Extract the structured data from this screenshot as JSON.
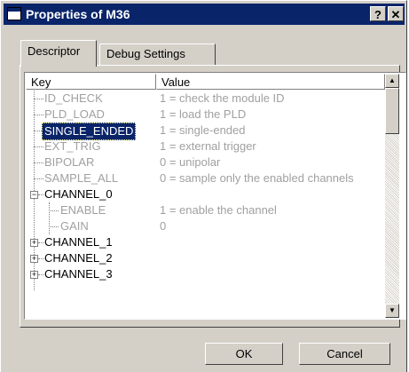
{
  "window": {
    "title": "Properties of M36",
    "help_label": "?",
    "close_label": "✕"
  },
  "tabs": [
    {
      "label": "Descriptor",
      "active": true
    },
    {
      "label": "Debug Settings",
      "active": false
    }
  ],
  "list": {
    "columns": {
      "key": "Key",
      "value": "Value"
    },
    "rows": [
      {
        "key": "ID_CHECK",
        "value": "1 = check the module ID",
        "enabled": false
      },
      {
        "key": "PLD_LOAD",
        "value": "1 = load the PLD",
        "enabled": false
      },
      {
        "key": "SINGLE_ENDED",
        "value": "1 = single-ended",
        "enabled": false,
        "selected": true
      },
      {
        "key": "EXT_TRIG",
        "value": "1 = external trigger",
        "enabled": false
      },
      {
        "key": "BIPOLAR",
        "value": "0 = unipolar",
        "enabled": false
      },
      {
        "key": "SAMPLE_ALL",
        "value": "0 = sample only the enabled channels",
        "enabled": false
      },
      {
        "key": "CHANNEL_0",
        "value": "",
        "enabled": true,
        "expander": "−"
      },
      {
        "key": "ENABLE",
        "value": "1 = enable the channel",
        "enabled": false
      },
      {
        "key": "GAIN",
        "value": "0",
        "enabled": false
      },
      {
        "key": "CHANNEL_1",
        "value": "",
        "enabled": true,
        "expander": "+"
      },
      {
        "key": "CHANNEL_2",
        "value": "",
        "enabled": true,
        "expander": "+"
      },
      {
        "key": "CHANNEL_3",
        "value": "",
        "enabled": true,
        "expander": "+"
      }
    ]
  },
  "buttons": {
    "ok": "OK",
    "cancel": "Cancel"
  },
  "colors": {
    "titlebar": "#0a246a",
    "selection": "#0a246a",
    "disabled_text": "#a0a0a0",
    "face": "#d4d0c8"
  }
}
